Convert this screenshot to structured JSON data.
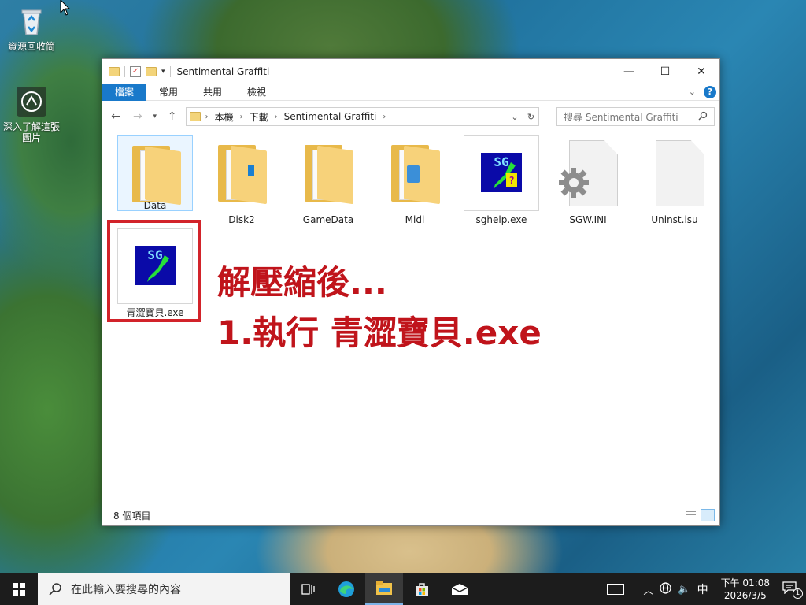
{
  "desktop": {
    "icons": [
      {
        "label": "資源回收筒",
        "icon": "recycle-bin-icon"
      },
      {
        "label": "深入了解這張圖片",
        "icon": "camera-info-icon"
      }
    ]
  },
  "window": {
    "title": "Sentimental Graffiti",
    "ribbon_tabs": [
      "檔案",
      "常用",
      "共用",
      "檢視"
    ],
    "address": {
      "crumbs": [
        "本機",
        "下載",
        "Sentimental Graffiti"
      ]
    },
    "search": {
      "placeholder": "搜尋 Sentimental Graffiti"
    },
    "items": [
      {
        "name": "Data",
        "type": "folder",
        "selected": true
      },
      {
        "name": "Disk2",
        "type": "folder"
      },
      {
        "name": "GameData",
        "type": "folder"
      },
      {
        "name": "Midi",
        "type": "folder"
      },
      {
        "name": "sghelp.exe",
        "type": "exe-help"
      },
      {
        "name": "SGW.INI",
        "type": "ini"
      },
      {
        "name": "Uninst.isu",
        "type": "file"
      },
      {
        "name": "青澀寶貝.exe",
        "type": "exe-game"
      }
    ],
    "status": {
      "count": "8 個項目"
    }
  },
  "annotation": {
    "line1": "解壓縮後...",
    "line2": "1.執行 青澀寶貝.exe",
    "color": "#c0141b"
  },
  "taskbar": {
    "search_placeholder": "在此輸入要搜尋的內容",
    "ime": "中",
    "time": "下午 01:08",
    "date": "2026/3/5",
    "notification_count": "1"
  }
}
